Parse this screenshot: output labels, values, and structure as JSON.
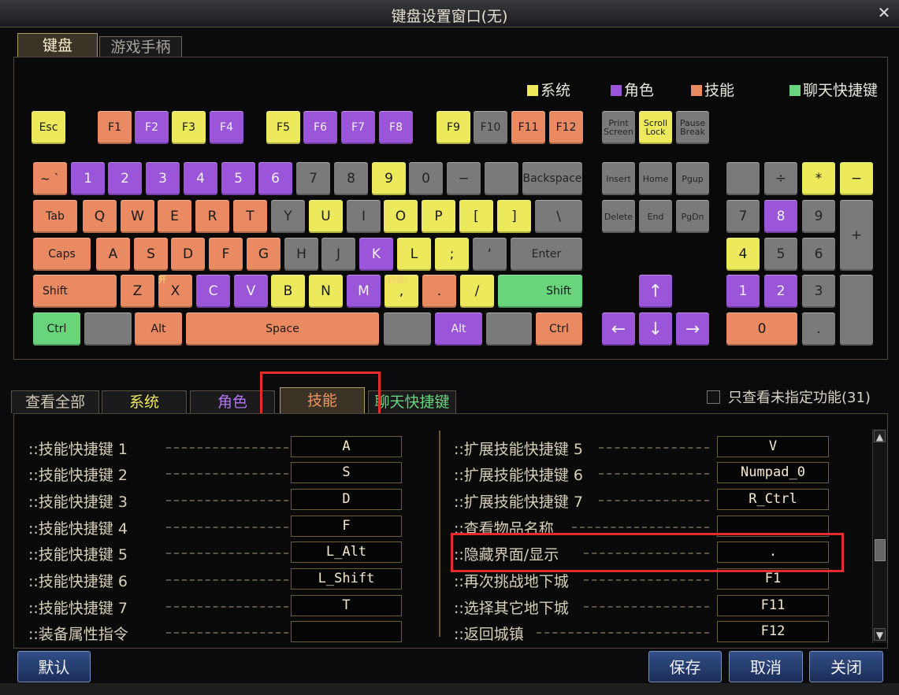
{
  "window": {
    "title": "键盘设置窗口(无)"
  },
  "top_tabs": [
    "键盘",
    "游戏手柄"
  ],
  "legend": [
    {
      "label": "系统",
      "color": "#ecea5c"
    },
    {
      "label": "角色",
      "color": "#9b55d9"
    },
    {
      "label": "技能",
      "color": "#ea8a62"
    },
    {
      "label": "聊天快捷键",
      "color": "#68d57d"
    }
  ],
  "keys": {
    "esc": "Esc",
    "f1": "F1",
    "f2": "F2",
    "f3": "F3",
    "f4": "F4",
    "f5": "F5",
    "f6": "F6",
    "f7": "F7",
    "f8": "F8",
    "f9": "F9",
    "f10": "F10",
    "f11": "F11",
    "f12": "F12",
    "print": "Print Screen",
    "scroll": "Scroll Lock",
    "pause": "Pause Break",
    "tilde": "~ `",
    "n1": "1",
    "n2": "2",
    "n3": "3",
    "n4": "4",
    "n5": "5",
    "n6": "6",
    "n7": "7",
    "n8": "8",
    "n9": "9",
    "n0": "0",
    "minus": "−",
    "equal": "",
    "backspace": "Backspace",
    "tab": "Tab",
    "q": "Q",
    "w": "W",
    "e": "E",
    "r": "R",
    "t": "T",
    "y": "Y",
    "u": "U",
    "i": "I",
    "o": "O",
    "p": "P",
    "lbr": "[",
    "rbr": "]",
    "bslash": "\\",
    "caps": "Caps",
    "a": "A",
    "s": "S",
    "d": "D",
    "f": "F",
    "g": "G",
    "h": "H",
    "j": "J",
    "k": "K",
    "l": "L",
    "semi": ";",
    "quote": "‘",
    "enter": "Enter",
    "lshift": "Shift",
    "z": "Z",
    "x": "X",
    "c": "C",
    "v": "V",
    "b": "B",
    "n": "N",
    "m": "M",
    "comma": ",",
    "period": ".",
    "slash": "/",
    "rshift": "Shift",
    "lctrl": "Ctrl",
    "lwin": "",
    "lalt": "Alt",
    "space": "Space",
    "ralt": "Alt",
    "rwin": "",
    "rctrl": "Ctrl",
    "insert": "Insert",
    "home": "Home",
    "pgup": "Pgup",
    "delete": "Delete",
    "end": "End",
    "pgdn": "PgDn",
    "up": "↑",
    "left": "←",
    "down": "↓",
    "right": "→",
    "numlock": "",
    "ndiv": "÷",
    "nmul": "*",
    "nsub": "−",
    "np7": "7",
    "np8": "8",
    "np9": "9",
    "nadd": "+",
    "np4": "4",
    "np5": "5",
    "np6": "6",
    "np1": "1",
    "np2": "2",
    "np3": "3",
    "nenter": "",
    "np0": "0",
    "ndot": "."
  },
  "key_badges": {
    "x": "开",
    "comma": "(快捷)"
  },
  "filter_tabs": [
    "查看全部",
    "系统",
    "角色",
    "技能",
    "聊天快捷键"
  ],
  "filter_checkbox": {
    "label": "只查看未指定功能(31)",
    "checked": false
  },
  "left_bindings": [
    {
      "label": "::技能快捷键 1",
      "key": "A"
    },
    {
      "label": "::技能快捷键 2",
      "key": "S"
    },
    {
      "label": "::技能快捷键 3",
      "key": "D"
    },
    {
      "label": "::技能快捷键 4",
      "key": "F"
    },
    {
      "label": "::技能快捷键 5",
      "key": "L_Alt"
    },
    {
      "label": "::技能快捷键 6",
      "key": "L_Shift"
    },
    {
      "label": "::技能快捷键 7",
      "key": "T"
    },
    {
      "label": "::装备属性指令",
      "key": ""
    }
  ],
  "right_bindings": [
    {
      "label": "::扩展技能快捷键 5",
      "key": "V"
    },
    {
      "label": "::扩展技能快捷键 6",
      "key": "Numpad_0"
    },
    {
      "label": "::扩展技能快捷键 7",
      "key": "R_Ctrl"
    },
    {
      "label": "::查看物品名称",
      "key": ""
    },
    {
      "label": "::隐藏界面/显示",
      "key": "."
    },
    {
      "label": "::再次挑战地下城",
      "key": "F1"
    },
    {
      "label": "::选择其它地下城",
      "key": "F11"
    },
    {
      "label": "::返回城镇",
      "key": "F12"
    }
  ],
  "buttons": {
    "default": "默认",
    "save": "保存",
    "cancel": "取消",
    "close": "关闭"
  }
}
